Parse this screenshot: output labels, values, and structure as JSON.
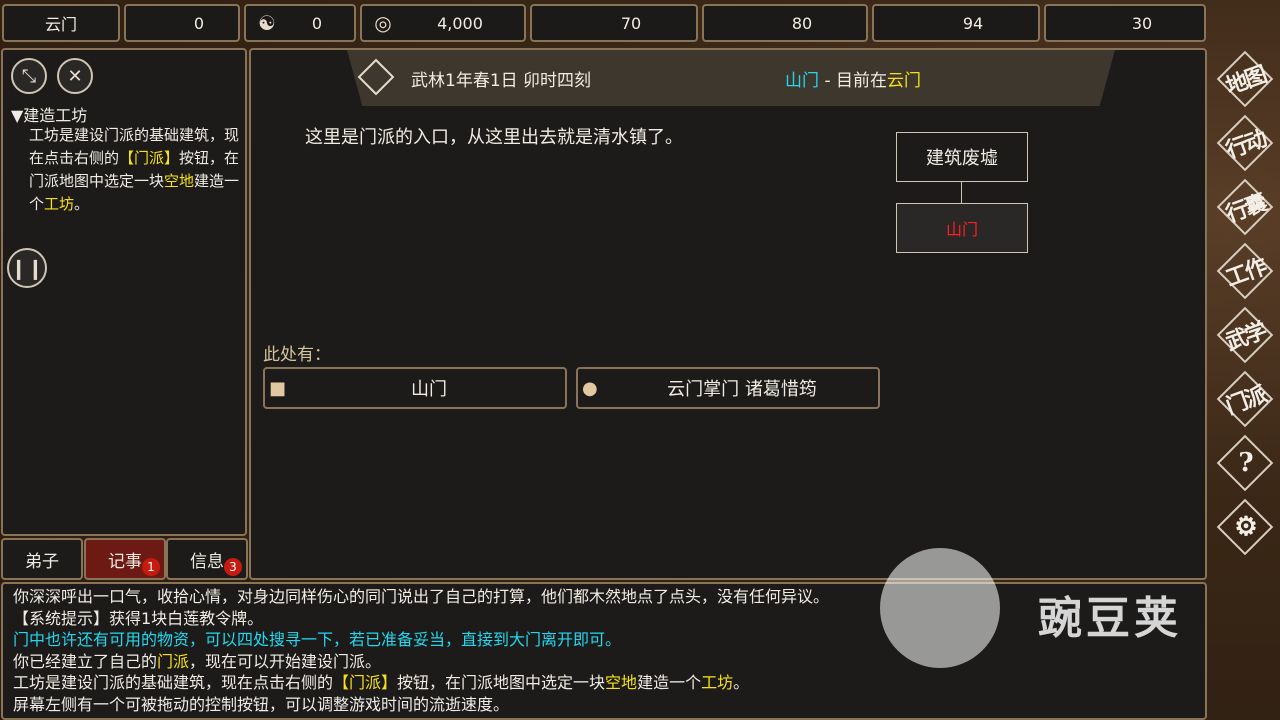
{
  "top_bar": {
    "sect_name": "云门",
    "resources": [
      {
        "icon": "prestige-icon",
        "glyph": "",
        "value": "0"
      },
      {
        "icon": "yin-yang-icon",
        "glyph": "☯",
        "value": "0"
      },
      {
        "icon": "coin-icon",
        "glyph": "◎",
        "value": "4,000"
      },
      {
        "icon": "food-bowl-icon",
        "glyph": "",
        "value": "70"
      },
      {
        "icon": "gourd-icon",
        "glyph": "",
        "value": "80"
      },
      {
        "icon": "wood-icon",
        "glyph": "",
        "value": "94"
      },
      {
        "icon": "ore-icon",
        "glyph": "",
        "value": "30"
      }
    ]
  },
  "quest": {
    "title": "▼建造工坊",
    "body_parts": [
      {
        "text": "工坊是建设门派的基础建筑，现在点击右侧的",
        "color": "white"
      },
      {
        "text": "【门派】",
        "color": "yellow"
      },
      {
        "text": "按钮，在门派地图中选定一块",
        "color": "white"
      },
      {
        "text": "空地",
        "color": "yellow"
      },
      {
        "text": "建造一个",
        "color": "white"
      },
      {
        "text": "工坊",
        "color": "yellow"
      },
      {
        "text": "。",
        "color": "white"
      }
    ]
  },
  "left_tabs": [
    {
      "label": "弟子",
      "badge": ""
    },
    {
      "label": "记事",
      "badge": "1"
    },
    {
      "label": "信息",
      "badge": "3"
    }
  ],
  "header": {
    "date": "武林1年春1日 卯时四刻",
    "location": "山门",
    "separator": " - ",
    "current_prefix": "目前在",
    "current_place": "云门"
  },
  "scene": {
    "description": "这里是门派的入口，从这里出去就是清水镇了。",
    "map_nodes": [
      "建筑废墟",
      "山门"
    ],
    "here_label": "此处有：",
    "entities": [
      {
        "icon": "box-icon",
        "label": "山门"
      },
      {
        "icon": "person-icon",
        "label": "云门掌门 诸葛惜筠"
      }
    ]
  },
  "log": [
    [
      {
        "text": "你深深呼出一口气，收拾心情，对身边同样伤心的同门说出了自己的打算，他们都木然地点了点头，没有任何异议。",
        "color": "white"
      }
    ],
    [
      {
        "text": "【系统提示】获得1块白莲教令牌。",
        "color": "white"
      }
    ],
    [
      {
        "text": "门中也许还有可用的物资，可以四处搜寻一下，若已准备妥当，直接到大门离开即可。",
        "color": "cyan"
      }
    ],
    [
      {
        "text": "你已经建立了自己的",
        "color": "white"
      },
      {
        "text": "门派",
        "color": "yellow"
      },
      {
        "text": "，现在可以开始建设门派。",
        "color": "white"
      }
    ],
    [
      {
        "text": "工坊是建设门派的基础建筑，现在点击右侧的",
        "color": "white"
      },
      {
        "text": "【门派】",
        "color": "yellow"
      },
      {
        "text": "按钮，在门派地图中选定一块",
        "color": "white"
      },
      {
        "text": "空地",
        "color": "yellow"
      },
      {
        "text": "建造一个",
        "color": "white"
      },
      {
        "text": "工坊",
        "color": "yellow"
      },
      {
        "text": "。",
        "color": "white"
      }
    ],
    [
      {
        "text": "屏幕左侧有一个可被拖动的控制按钮，可以调整游戏时间的流逝速度。",
        "color": "white"
      }
    ]
  ],
  "right_menu": [
    "地图",
    "行动",
    "行囊",
    "工作",
    "武学",
    "门派",
    "?",
    "⚙"
  ],
  "watermark": "豌豆荚",
  "colors": {
    "accent_yellow": "#f5e01a",
    "accent_cyan": "#22d8f0",
    "accent_red": "#ff2020",
    "panel_border": "#8a7458"
  }
}
